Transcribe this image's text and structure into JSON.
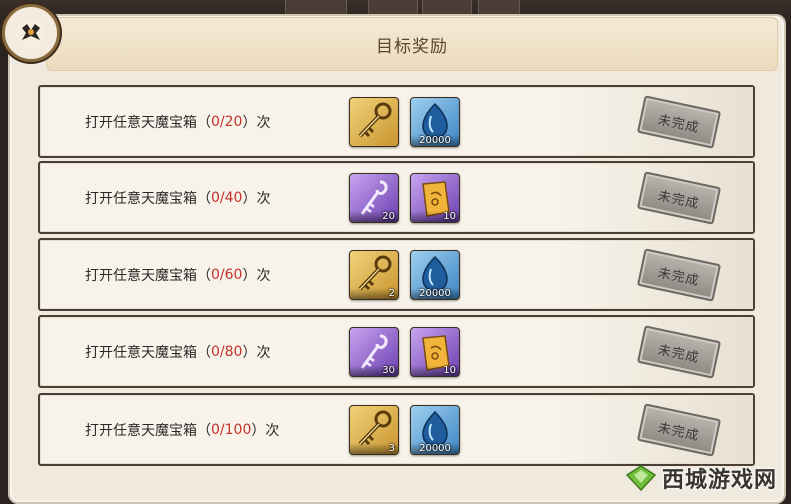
{
  "panel": {
    "title": "目标奖励"
  },
  "tasks": [
    {
      "label_prefix": "打开任意天魔宝箱（",
      "progress": "0/20",
      "label_suffix": "）次",
      "rewards": [
        {
          "icon": "golden-key-icon",
          "style": "gold",
          "qty": ""
        },
        {
          "icon": "blue-crystal-icon",
          "style": "blue",
          "qty": "20000"
        }
      ],
      "status": "未完成"
    },
    {
      "label_prefix": "打开任意天魔宝箱（",
      "progress": "0/40",
      "label_suffix": "）次",
      "rewards": [
        {
          "icon": "purple-key-icon",
          "style": "purple",
          "qty": "20"
        },
        {
          "icon": "golden-scroll-icon",
          "style": "purple",
          "qty": "10"
        }
      ],
      "status": "未完成"
    },
    {
      "label_prefix": "打开任意天魔宝箱（",
      "progress": "0/60",
      "label_suffix": "）次",
      "rewards": [
        {
          "icon": "golden-key-icon",
          "style": "gold",
          "qty": "2"
        },
        {
          "icon": "blue-crystal-icon",
          "style": "blue",
          "qty": "20000"
        }
      ],
      "status": "未完成"
    },
    {
      "label_prefix": "打开任意天魔宝箱（",
      "progress": "0/80",
      "label_suffix": "）次",
      "rewards": [
        {
          "icon": "purple-key-icon",
          "style": "purple",
          "qty": "30"
        },
        {
          "icon": "golden-scroll-icon",
          "style": "purple",
          "qty": "10"
        }
      ],
      "status": "未完成"
    },
    {
      "label_prefix": "打开任意天魔宝箱（",
      "progress": "0/100",
      "label_suffix": "）次",
      "rewards": [
        {
          "icon": "golden-key-icon",
          "style": "gold",
          "qty": "3"
        },
        {
          "icon": "blue-crystal-icon",
          "style": "blue",
          "qty": "20000"
        }
      ],
      "status": "未完成"
    }
  ],
  "watermark": {
    "text": "西城游戏网"
  },
  "colors": {
    "progress": "#c3322c",
    "row_border": "#4a3e35",
    "panel": "#efe9de"
  }
}
